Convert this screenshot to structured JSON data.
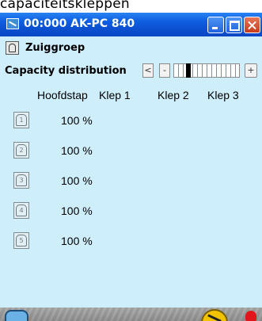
{
  "caption": "capaciteitskleppen",
  "window": {
    "title": "00:000 AK-PC 840"
  },
  "group": {
    "label": "Zuiggroep"
  },
  "capacity": {
    "label": "Capacity distribution",
    "prev_symbol": "<",
    "minus_symbol": "-",
    "plus_symbol": "+"
  },
  "table": {
    "headers": [
      "Hoofdstap",
      "Klep 1",
      "Klep 2",
      "Klep 3"
    ],
    "rows": [
      {
        "icon_number": "1",
        "value": "100 %"
      },
      {
        "icon_number": "2",
        "value": "100 %"
      },
      {
        "icon_number": "3",
        "value": "100 %"
      },
      {
        "icon_number": "4",
        "value": "100 %"
      },
      {
        "icon_number": "5",
        "value": "100 %"
      }
    ]
  },
  "colors": {
    "titlebar": "#0b4fcf",
    "background": "#cfeefb",
    "close_button": "#c73b18",
    "alarm": "#e2161a"
  }
}
